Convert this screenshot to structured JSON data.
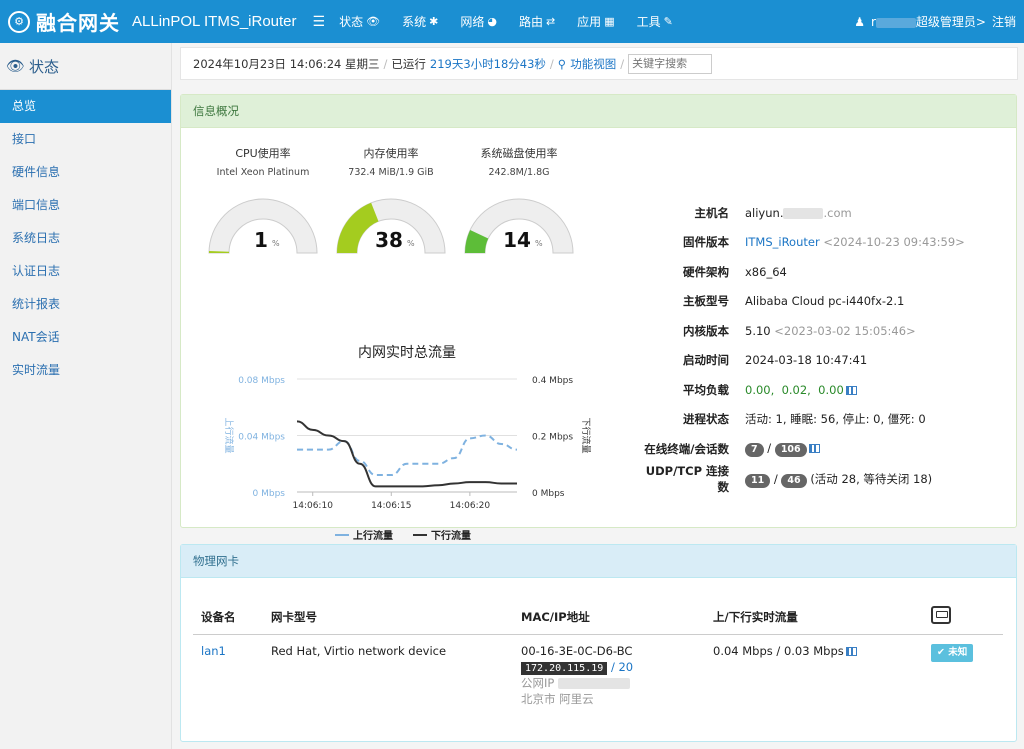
{
  "topbar": {
    "logo_glyph": "⚙",
    "brand": "融合网关",
    "app_title": "ALLinPOL ITMS_iRouter",
    "menu_icon": "menu-icon",
    "nav": [
      {
        "label": "状态",
        "icon": "👁"
      },
      {
        "label": "系统",
        "icon": "✱"
      },
      {
        "label": "网络",
        "icon": "◕"
      },
      {
        "label": "路由",
        "icon": "⇄"
      },
      {
        "label": "应用",
        "icon": "▦"
      },
      {
        "label": "工具",
        "icon": "✎"
      }
    ],
    "user_prefix": "r",
    "user_role": "超级管理员>",
    "logout": "注销"
  },
  "sidebar": {
    "header": "状态",
    "items": [
      {
        "label": "总览"
      },
      {
        "label": "接口"
      },
      {
        "label": "硬件信息"
      },
      {
        "label": "端口信息"
      },
      {
        "label": "系统日志"
      },
      {
        "label": "认证日志"
      },
      {
        "label": "统计报表"
      },
      {
        "label": "NAT会话"
      },
      {
        "label": "实时流量"
      }
    ]
  },
  "crumbs": {
    "datetime": "2024年10月23日 14:06:24 星期三",
    "uptime_label": "已运行",
    "uptime_value": "219天3小时18分43秒",
    "func_view": "功能视图",
    "search_placeholder": "关键字搜索"
  },
  "overview": {
    "title": "信息概况",
    "gauges": [
      {
        "title": "CPU使用率",
        "sub": "Intel Xeon Platinum",
        "value": 1,
        "unit": "%"
      },
      {
        "title": "内存使用率",
        "sub": "732.4 MiB/1.9 GiB",
        "value": 38,
        "unit": "%"
      },
      {
        "title": "系统磁盘使用率",
        "sub": "242.8M/1.8G",
        "value": 14,
        "unit": "%"
      }
    ],
    "gauge_color": "#a4cc1f",
    "gauge_color_disk": "#5dbd38"
  },
  "chart_data": {
    "type": "line",
    "title": "内网实时总流量",
    "x": [
      "14:06:09",
      "14:06:10",
      "14:06:11",
      "14:06:12",
      "14:06:13",
      "14:06:14",
      "14:06:15",
      "14:06:16",
      "14:06:17",
      "14:06:18",
      "14:06:19",
      "14:06:20",
      "14:06:21",
      "14:06:22",
      "14:06:23"
    ],
    "x_ticks": [
      "14:06:10",
      "14:06:15",
      "14:06:20"
    ],
    "y_left_label": "上行流量",
    "y_left_ticks": [
      "0 Mbps",
      "0.04 Mbps",
      "0.08 Mbps"
    ],
    "y_left_range": [
      0,
      0.08
    ],
    "y_right_label": "下行流量",
    "y_right_ticks": [
      "0 Mbps",
      "0.2 Mbps",
      "0.4 Mbps"
    ],
    "y_right_range": [
      0,
      0.4
    ],
    "series": [
      {
        "name": "上行流量",
        "axis": "left",
        "color": "#7fb2e0",
        "dashed": true,
        "values": [
          0.03,
          0.03,
          0.03,
          0.036,
          0.022,
          0.012,
          0.012,
          0.02,
          0.02,
          0.02,
          0.024,
          0.038,
          0.04,
          0.034,
          0.03
        ]
      },
      {
        "name": "下行流量",
        "axis": "right",
        "color": "#333333",
        "dashed": false,
        "values": [
          0.25,
          0.22,
          0.2,
          0.18,
          0.1,
          0.02,
          0.02,
          0.02,
          0.02,
          0.024,
          0.03,
          0.035,
          0.035,
          0.03,
          0.03
        ]
      }
    ],
    "legend": "bottom",
    "grid": true
  },
  "info": {
    "rows": [
      {
        "label": "主机名",
        "value": "aliyun.",
        "tail": ".com"
      },
      {
        "label": "固件版本",
        "link": "ITMS_iRouter",
        "muted": "<2024-10-23 09:43:59>"
      },
      {
        "label": "硬件架构",
        "value": "x86_64"
      },
      {
        "label": "主板型号",
        "value": "Alibaba Cloud pc-i440fx-2.1"
      },
      {
        "label": "内核版本",
        "value": "5.10",
        "muted": "<2023-03-02 15:05:46>"
      },
      {
        "label": "启动时间",
        "value": "2024-03-18 10:47:41"
      },
      {
        "label": "平均负载",
        "load1": "0.00,",
        "load2": "0.02,",
        "load3": "0.00"
      },
      {
        "label": "进程状态",
        "value": "活动: 1,  睡眠: 56,  停止: 0,  僵死: 0"
      },
      {
        "label": "在线终端/会话数",
        "badge1": "7",
        "sep": "/",
        "badge2": "106"
      },
      {
        "label": "UDP/TCP 连接数",
        "badge1": "11",
        "sep": "/",
        "badge2": "46",
        "extra": "(活动 28, 等待关闭 18)"
      }
    ]
  },
  "nic": {
    "title": "物理网卡",
    "headers": [
      "设备名",
      "网卡型号",
      "MAC/IP地址",
      "上/下行实时流量"
    ],
    "rows": [
      {
        "device": "lan1",
        "model": "Red Hat, Virtio network device",
        "mac": "00-16-3E-0C-D6-BC",
        "ip": "172.20.115.19",
        "mask": "/ 20",
        "public_ip_label": "公网IP",
        "location": "北京市 阿里云",
        "traffic": "0.04 Mbps / 0.03 Mbps",
        "status": "✔ 未知"
      }
    ]
  }
}
